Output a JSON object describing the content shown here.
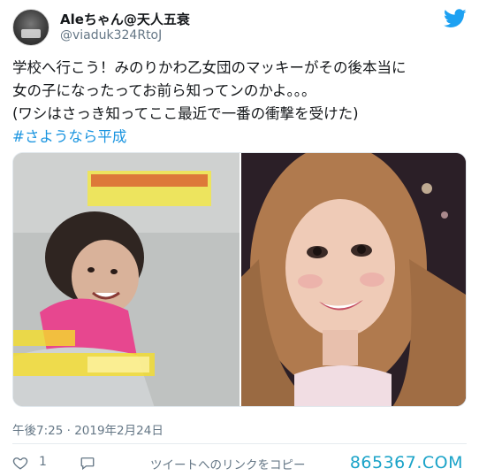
{
  "user": {
    "display_name": "Aleちゃん@天人五衰",
    "handle": "@viaduk324RtoJ"
  },
  "tweet": {
    "lines": [
      "学校へ行こう！みのりかわ乙女団のマッキーがその後本当に",
      "女の子になったってお前ら知ってンのかよ。。。",
      "(ワシはさっき知ってここ最近で一番の衝撃を受けた)"
    ],
    "hashtag": "#さようなら平成"
  },
  "media": {
    "left_photo": "photo-before",
    "right_photo": "photo-after"
  },
  "timestamp": "午後7:25 · 2019年2月24日",
  "actions": {
    "like_count": "1",
    "share_label": "ツイートへのリンクをコピー"
  },
  "watermark": "865367.COM",
  "colors": {
    "twitter_blue": "#1da1f2",
    "hashtag": "#1b95e0",
    "secondary_text": "#657786",
    "watermark": "#1aa3c8"
  },
  "icons": {
    "brand": "twitter-bird-icon",
    "like": "heart-icon",
    "comment": "comment-bubble-icon"
  }
}
